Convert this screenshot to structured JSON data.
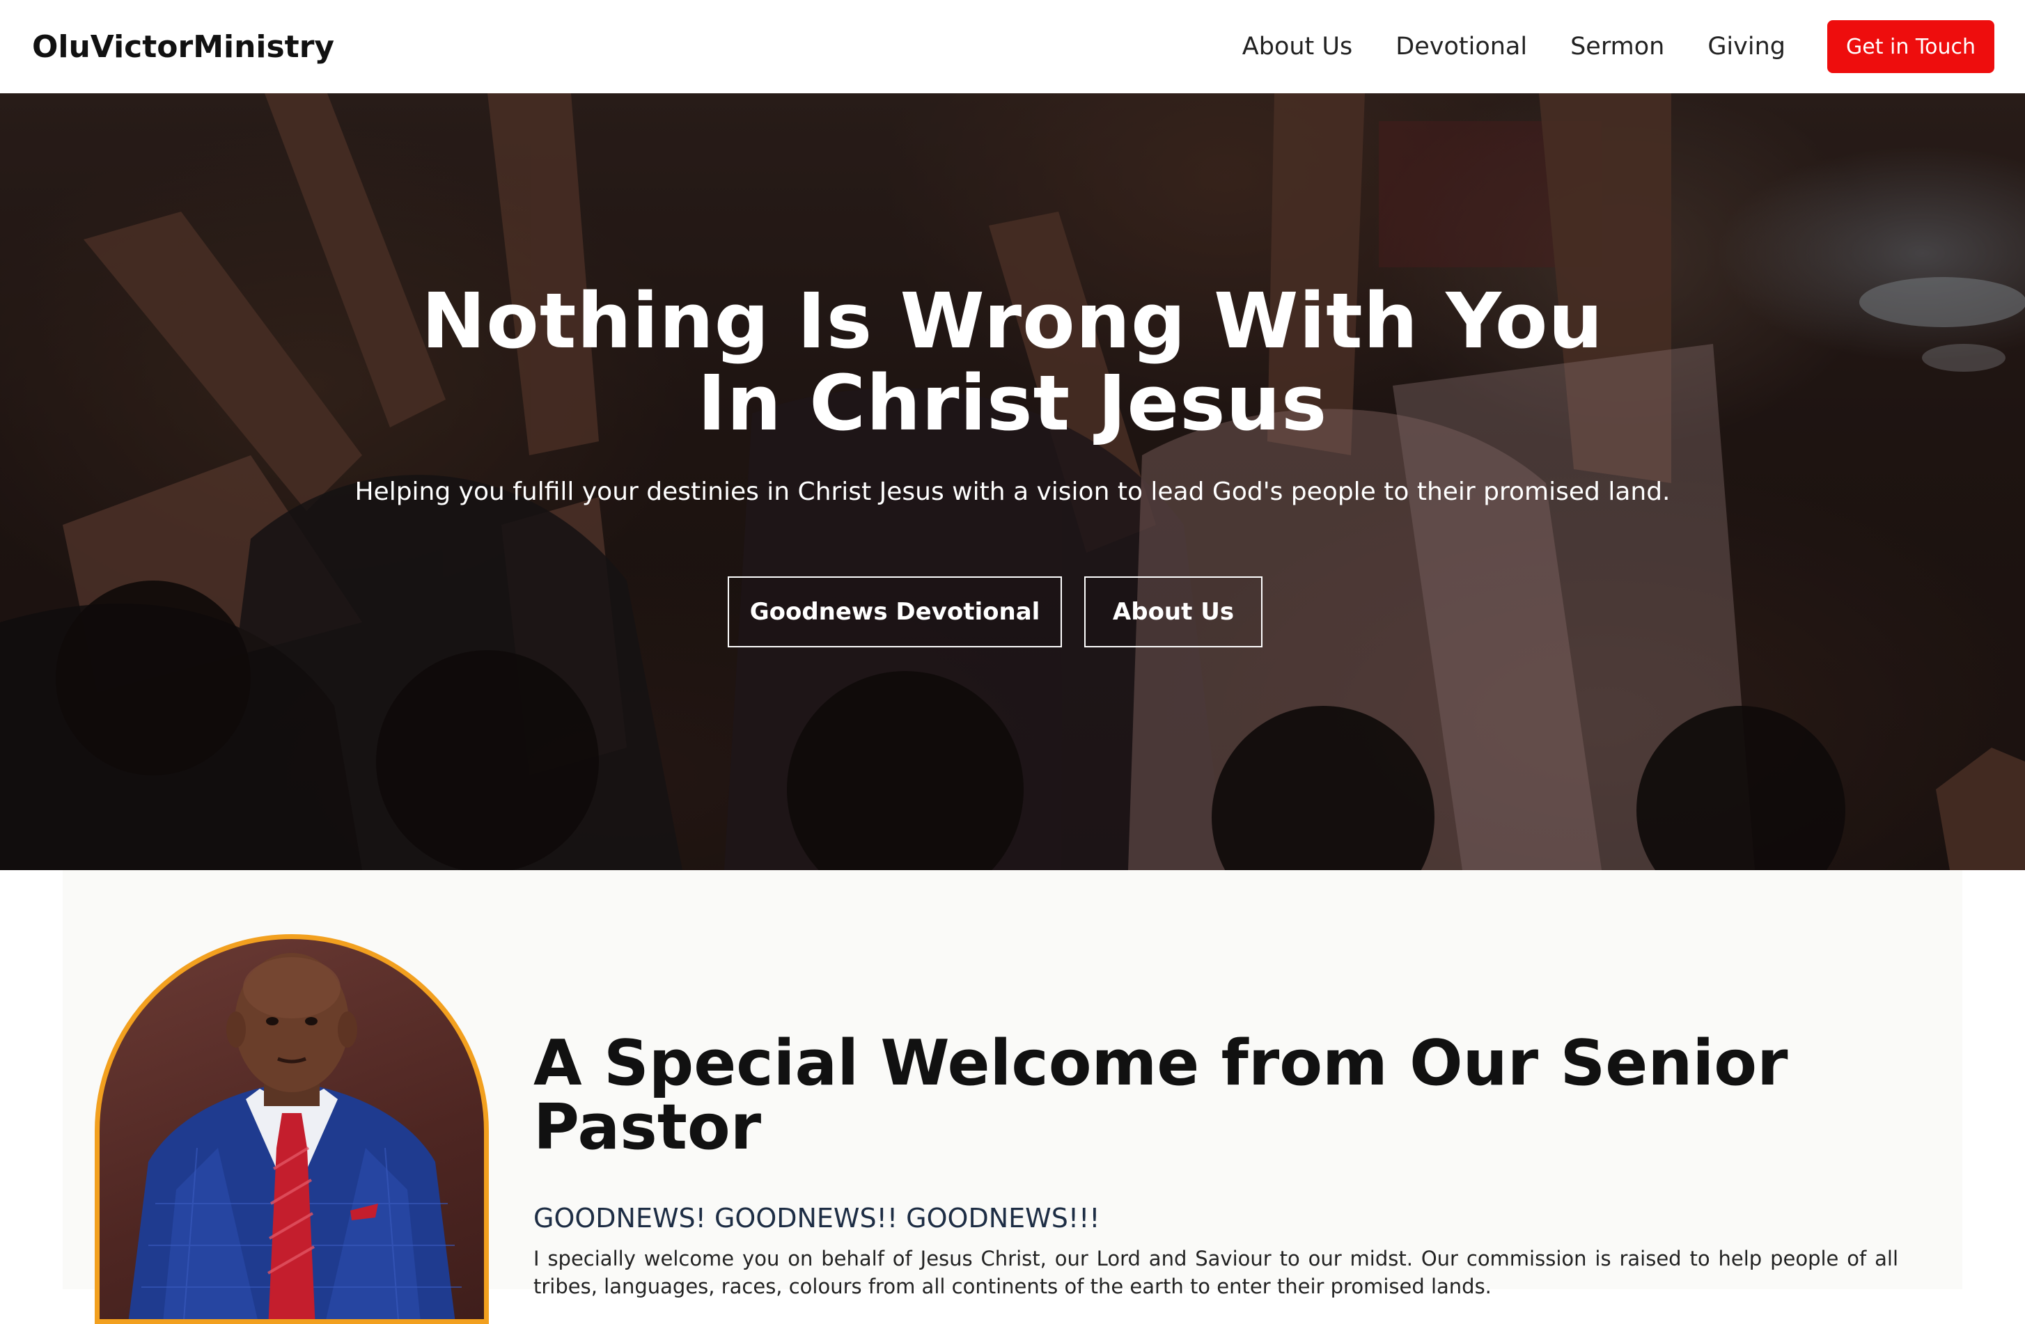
{
  "header": {
    "brand": "OluVictorMinistry",
    "nav": [
      {
        "label": "About Us"
      },
      {
        "label": "Devotional"
      },
      {
        "label": "Sermon"
      },
      {
        "label": "Giving"
      }
    ],
    "cta_label": "Get in Touch"
  },
  "hero": {
    "title_line1": "Nothing Is Wrong With You",
    "title_line2": "In Christ Jesus",
    "subtitle": "Helping you fulfill your destinies in Christ Jesus with a vision to lead God's people to their promised land.",
    "buttons": [
      {
        "label": "Goodnews Devotional"
      },
      {
        "label": "About Us"
      }
    ]
  },
  "welcome": {
    "title": "A Special Welcome from Our Senior Pastor",
    "kicker": "GOODNEWS! GOODNEWS!! GOODNEWS!!!",
    "body": "I specially welcome you on behalf of Jesus Christ, our Lord and Saviour to our midst. Our commission is raised to help people of all tribes, languages, races, colours from all continents of the earth to enter their promised lands."
  },
  "colors": {
    "accent_red": "#ee0d0d",
    "portrait_border": "#f2a01f",
    "kicker_blue": "#1d2d44"
  }
}
